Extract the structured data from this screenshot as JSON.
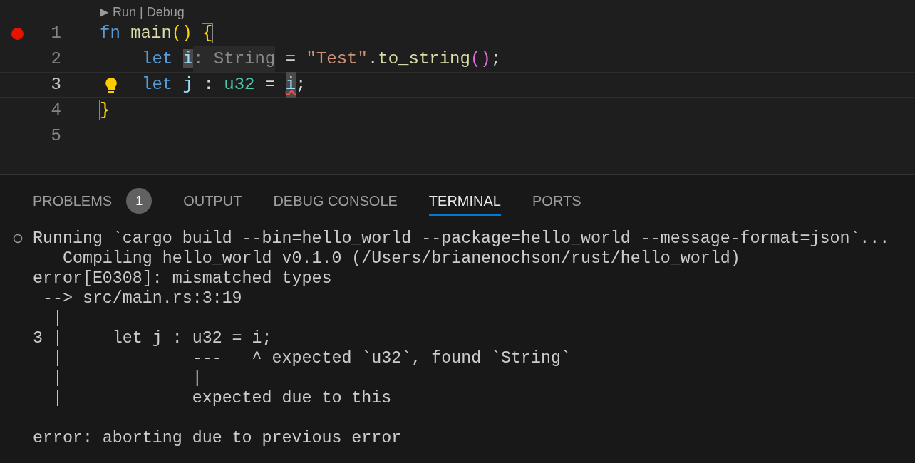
{
  "editor": {
    "run_glyph": "▶",
    "codelens": "Run | Debug",
    "lines": [
      {
        "number": "1",
        "breakpoint": true,
        "current": false,
        "lightbulb": false,
        "indented": false,
        "tokens": [
          {
            "text": "fn",
            "kind": "keyword"
          },
          {
            "text": " main",
            "kind": "function"
          },
          {
            "text": "()",
            "kind": "bracket"
          },
          {
            "text": " {",
            "kind": "bracket-match"
          }
        ]
      },
      {
        "number": "2",
        "breakpoint": false,
        "current": false,
        "lightbulb": false,
        "indented": true,
        "tokens": [
          {
            "text": "let",
            "kind": "keyword"
          },
          {
            "text": " i",
            "kind": "variable-highlight"
          },
          {
            "text": ": String",
            "kind": "hint"
          },
          {
            "text": " = ",
            "kind": "plain"
          },
          {
            "text": "\"Test\"",
            "kind": "string"
          },
          {
            "text": ".",
            "kind": "plain"
          },
          {
            "text": "to_string",
            "kind": "function"
          },
          {
            "text": "()",
            "kind": "bracket2"
          },
          {
            "text": ";",
            "kind": "plain"
          }
        ]
      },
      {
        "number": "3",
        "breakpoint": false,
        "current": true,
        "lightbulb": true,
        "indented": true,
        "tokens": [
          {
            "text": "let",
            "kind": "keyword"
          },
          {
            "text": " j",
            "kind": "variable"
          },
          {
            "text": " : ",
            "kind": "plain"
          },
          {
            "text": "u32",
            "kind": "type"
          },
          {
            "text": " = ",
            "kind": "plain"
          },
          {
            "text": "i",
            "kind": "variable-error"
          },
          {
            "text": ";",
            "kind": "plain"
          }
        ]
      },
      {
        "number": "4",
        "breakpoint": false,
        "current": false,
        "lightbulb": false,
        "indented": false,
        "tokens": [
          {
            "text": "}",
            "kind": "bracket-match"
          }
        ]
      },
      {
        "number": "5",
        "breakpoint": false,
        "current": false,
        "lightbulb": false,
        "indented": false
      }
    ]
  },
  "panel": {
    "tabs": [
      {
        "label": "PROBLEMS",
        "badge": "1",
        "selected": false
      },
      {
        "label": "OUTPUT",
        "selected": false
      },
      {
        "label": "DEBUG CONSOLE",
        "selected": false
      },
      {
        "label": "TERMINAL",
        "selected": true
      },
      {
        "label": "PORTS",
        "selected": false
      }
    ],
    "terminal": [
      {
        "text": "Running `cargo build --bin=hello_world --package=hello_world --message-format=json`...",
        "task": true
      },
      {
        "text": "   Compiling hello_world v0.1.0 (/Users/brianenochson/rust/hello_world)",
        "task": false
      },
      {
        "text": "error[E0308]: mismatched types",
        "task": false
      },
      {
        "text": " --> src/main.rs:3:19",
        "task": false
      },
      {
        "text": "  |",
        "task": false
      },
      {
        "text": "3 |     let j : u32 = i;",
        "task": false
      },
      {
        "text": "  |             ---   ^ expected `u32`, found `String`",
        "task": false
      },
      {
        "text": "  |             |",
        "task": false
      },
      {
        "text": "  |             expected due to this",
        "task": false
      },
      {
        "task": false
      },
      {
        "text": "error: aborting due to previous error",
        "task": false
      }
    ]
  }
}
